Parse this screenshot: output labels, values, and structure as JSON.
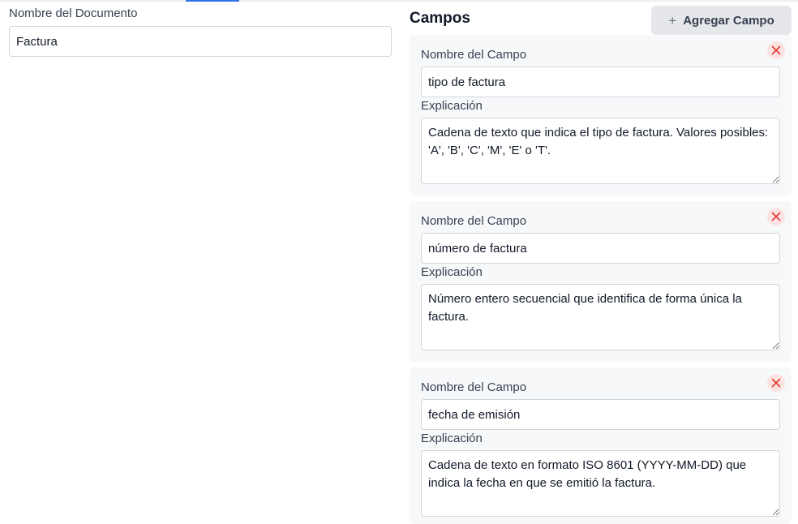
{
  "document": {
    "name_label": "Nombre del Documento",
    "name_value": "Factura"
  },
  "fields_section": {
    "title": "Campos",
    "add_button_label": "Agregar Campo",
    "add_icon": "plus-icon",
    "remove_icon": "close-x-icon"
  },
  "fields": [
    {
      "name_label": "Nombre del Campo",
      "name_value": "tipo de factura",
      "explanation_label": "Explicación",
      "explanation_value": "Cadena de texto que indica el tipo de factura. Valores posibles: 'A', 'B', 'C', 'M', 'E' o 'T'."
    },
    {
      "name_label": "Nombre del Campo",
      "name_value": "número de factura",
      "explanation_label": "Explicación",
      "explanation_value": "Número entero secuencial que identifica de forma única la factura."
    },
    {
      "name_label": "Nombre del Campo",
      "name_value": "fecha de emisión",
      "explanation_label": "Explicación",
      "explanation_value": "Cadena de texto en formato ISO 8601 (YYYY-MM-DD) que indica la fecha en que se emitió la factura."
    }
  ],
  "colors": {
    "accent": "#2f6fe8",
    "remove_icon": "#e53935",
    "remove_icon_bg": "#fde2e2",
    "card_bg": "#f7f8fa"
  }
}
